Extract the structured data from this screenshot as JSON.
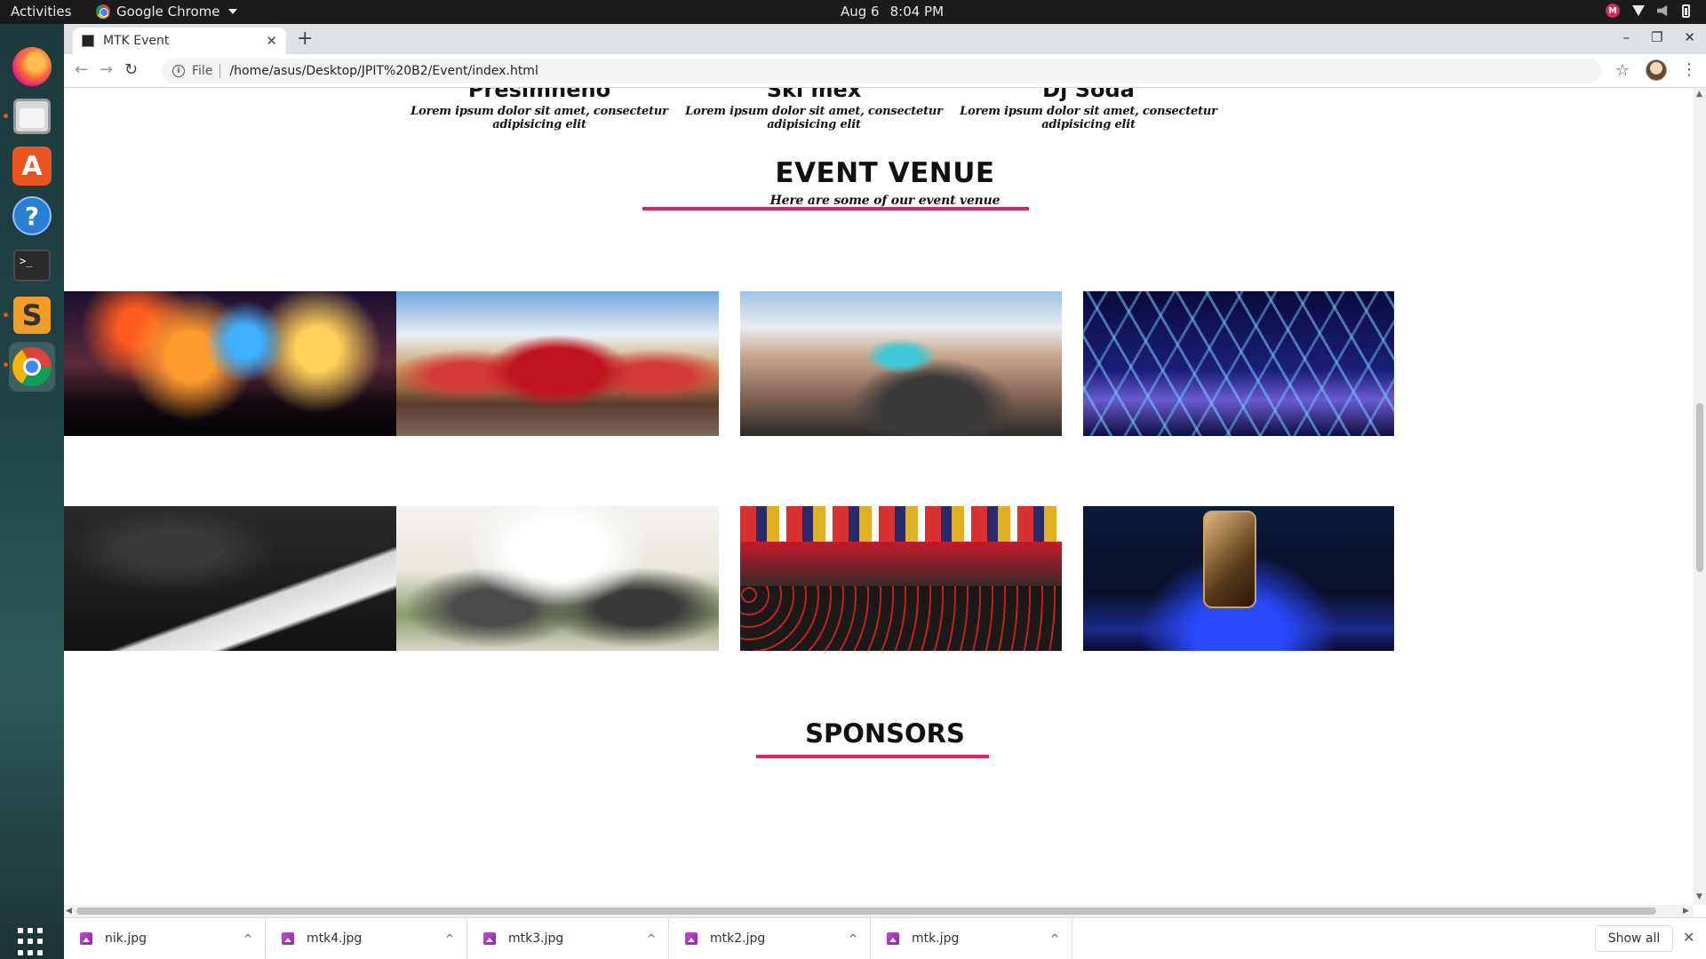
{
  "topbar": {
    "activities": "Activities",
    "app_name": "Google Chrome",
    "date": "Aug 6",
    "time": "8:04 PM",
    "tray_badge": "M"
  },
  "dock": {
    "items": [
      "firefox",
      "files",
      "ubuntu-software",
      "help",
      "terminal",
      "sublime-text",
      "google-chrome"
    ],
    "store_glyph": "A",
    "help_glyph": "?",
    "terminal_glyph": ">_",
    "sublime_glyph": "S"
  },
  "browser": {
    "tab_title": "MTK Event",
    "tab_close": "✕",
    "new_tab": "+",
    "window_controls": [
      "–",
      "❐",
      "✕"
    ],
    "url_scheme": "File",
    "url": "/home/asus/Desktop/JPIT%20B2/Event/index.html"
  },
  "page": {
    "team": [
      {
        "name": "Presimneno",
        "desc": "Lorem ipsum dolor sit amet, consectetur adipisicing elit"
      },
      {
        "name": "Ski mex",
        "desc": "Lorem ipsum dolor sit amet, consectetur adipisicing elit"
      },
      {
        "name": "Dj Soda",
        "desc": "Lorem ipsum dolor sit amet, consectetur adipisicing elit"
      }
    ],
    "venue_title": "EVENT VENUE",
    "venue_subtitle": "Here are some of our event venue",
    "venues": [
      "festival-stage-fireworks",
      "circus-tent-festival",
      "cruise-ship-party",
      "laser-show-arena",
      "fashion-runway",
      "outdoor-wedding",
      "graduation-ceremony",
      "smartphone-launch"
    ],
    "sponsors_title": "SPONSORS",
    "accent_color": "#e0245e"
  },
  "downloads": {
    "files": [
      "nik.jpg",
      "mtk4.jpg",
      "mtk3.jpg",
      "mtk2.jpg",
      "mtk.jpg"
    ],
    "caret": "^",
    "show_all": "Show all",
    "close": "✕"
  }
}
